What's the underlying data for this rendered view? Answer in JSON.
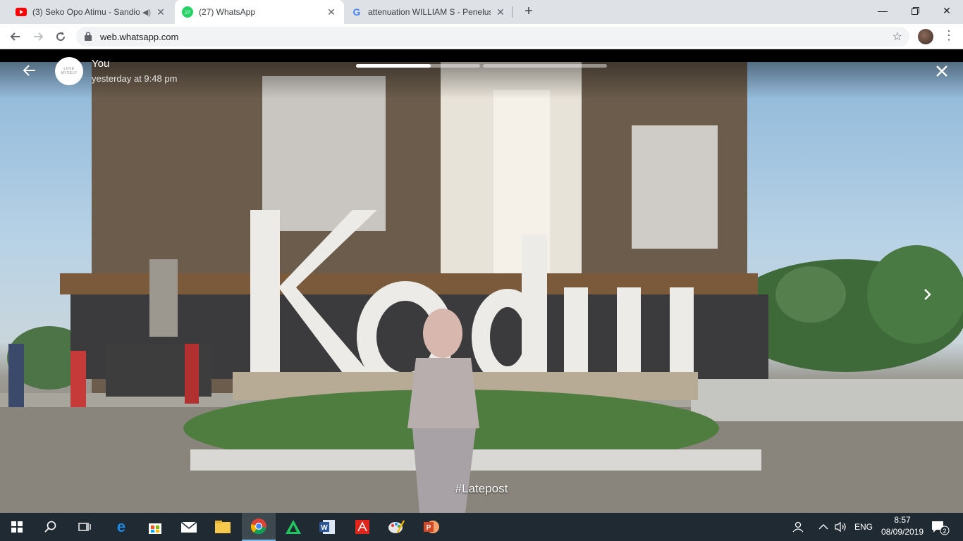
{
  "browser": {
    "tabs": [
      {
        "title": "(3) Seko Opo Atimu - Sandio",
        "icon": "youtube-icon",
        "audio": "speaker-icon"
      },
      {
        "title": "(27) WhatsApp",
        "icon": "whatsapp-icon",
        "badge": "27"
      },
      {
        "title": "attenuation WILLIAM S - Penelus",
        "icon": "google-icon"
      }
    ],
    "url": "web.whatsapp.com",
    "accent": "#1a73e8"
  },
  "status": {
    "name": "You",
    "time": "yesterday at 9:48 pm",
    "caption": "#Latepost",
    "avatar_text": "LOVE MYSELF",
    "progress": [
      0.6,
      0.0,
      0.0
    ]
  },
  "taskbar": {
    "apps": [
      "start-icon",
      "search-icon",
      "task-view-icon",
      "edge-icon",
      "store-icon",
      "mail-icon",
      "file-explorer-icon",
      "chrome-icon",
      "green-app-icon",
      "word-icon",
      "acrobat-icon",
      "paint-icon",
      "powerpoint-icon"
    ],
    "lang": "ENG",
    "time": "8:57",
    "date": "08/09/2019",
    "notifications": "2"
  }
}
